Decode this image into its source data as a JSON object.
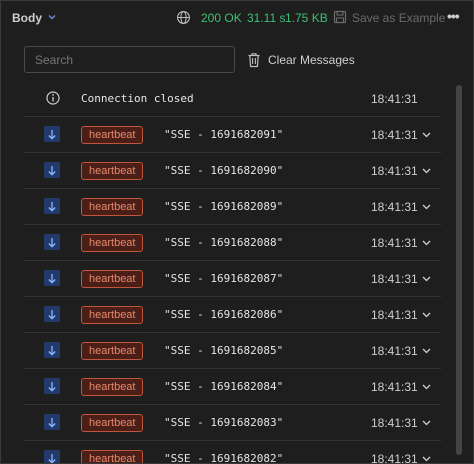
{
  "toolbar": {
    "body_label": "Body",
    "status": "200 OK",
    "time": "31.11 s",
    "size": "1.75 KB",
    "save_label": "Save as Example",
    "more_label": "•••"
  },
  "messages_toolbar": {
    "search_placeholder": "Search",
    "clear_label": "Clear Messages"
  },
  "colors": {
    "status_ok": "#3fbf74",
    "badge_border": "#c0563b",
    "badge_text": "#e8886d",
    "arrow_bg": "#213a6b"
  },
  "connection": {
    "text": "Connection closed",
    "time": "18:41:31",
    "icon": "info-icon"
  },
  "messages": [
    {
      "event": "heartbeat",
      "data": "\"SSE - 1691682091\"",
      "time": "18:41:31"
    },
    {
      "event": "heartbeat",
      "data": "\"SSE - 1691682090\"",
      "time": "18:41:31"
    },
    {
      "event": "heartbeat",
      "data": "\"SSE - 1691682089\"",
      "time": "18:41:31"
    },
    {
      "event": "heartbeat",
      "data": "\"SSE - 1691682088\"",
      "time": "18:41:31"
    },
    {
      "event": "heartbeat",
      "data": "\"SSE - 1691682087\"",
      "time": "18:41:31"
    },
    {
      "event": "heartbeat",
      "data": "\"SSE - 1691682086\"",
      "time": "18:41:31"
    },
    {
      "event": "heartbeat",
      "data": "\"SSE - 1691682085\"",
      "time": "18:41:31"
    },
    {
      "event": "heartbeat",
      "data": "\"SSE - 1691682084\"",
      "time": "18:41:31"
    },
    {
      "event": "heartbeat",
      "data": "\"SSE - 1691682083\"",
      "time": "18:41:31"
    },
    {
      "event": "heartbeat",
      "data": "\"SSE - 1691682082\"",
      "time": "18:41:31"
    }
  ]
}
